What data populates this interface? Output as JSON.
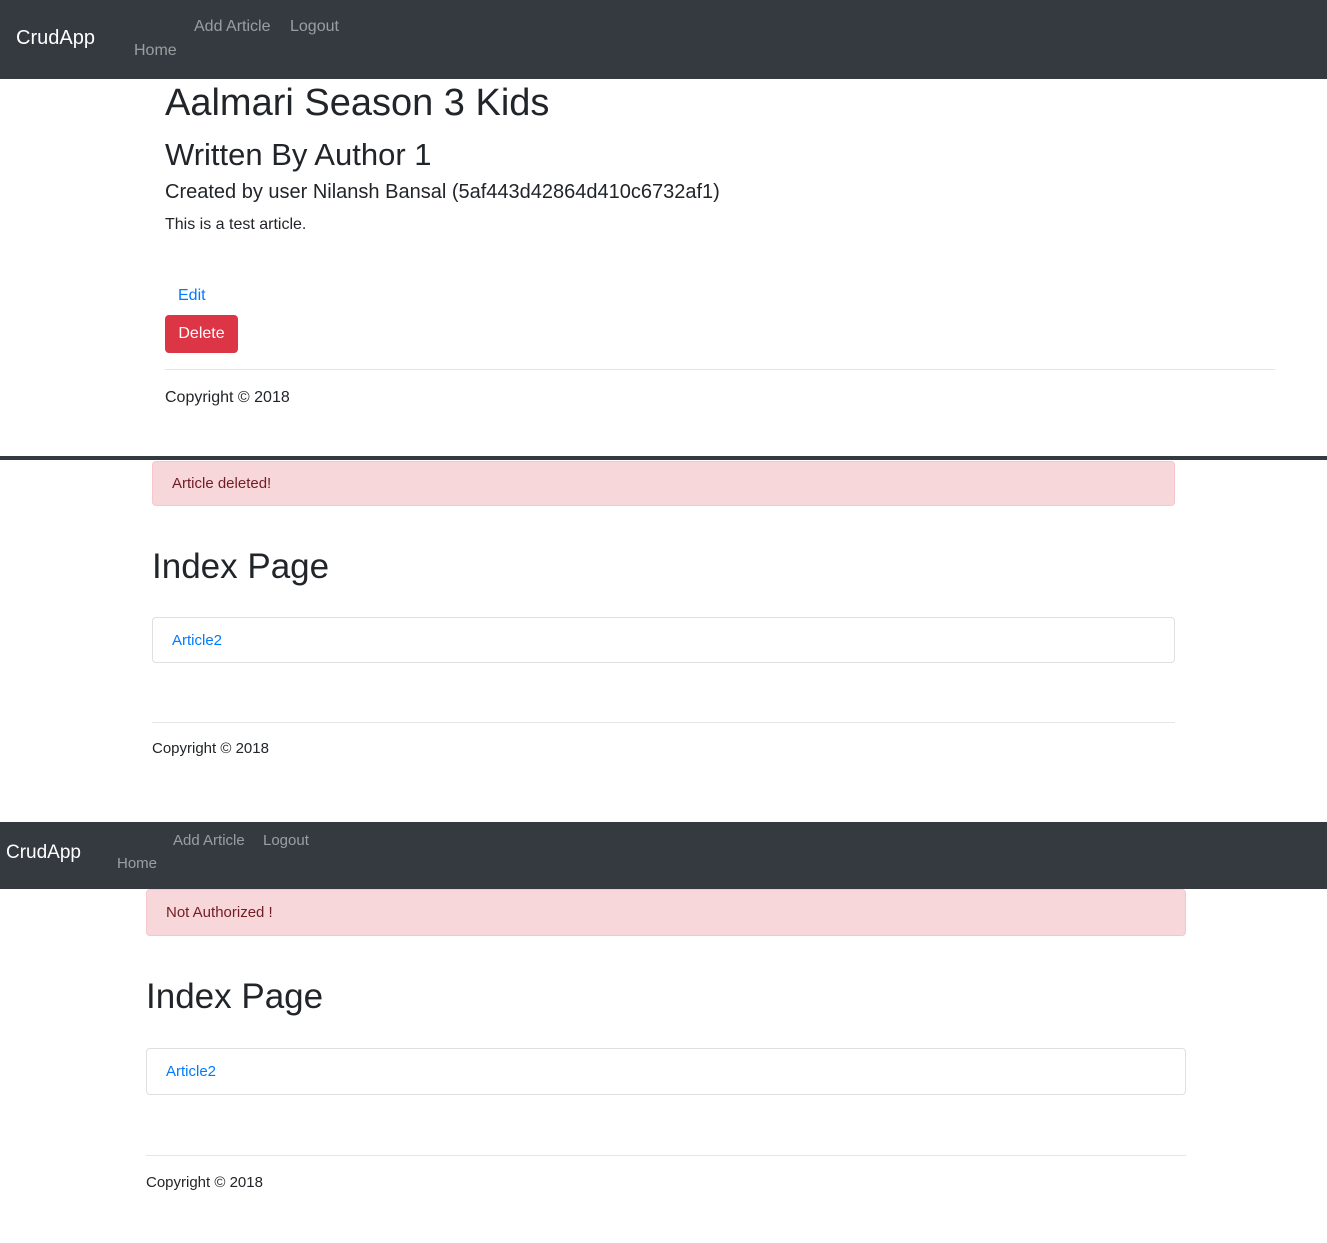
{
  "screen1": {
    "navbar": {
      "brand": "CrudApp",
      "links": [
        "Home",
        "Add Article",
        "Logout"
      ]
    },
    "article": {
      "title": "Aalmari Season 3 Kids",
      "author_line": "Written By Author 1",
      "created_line": "Created by user Nilansh Bansal (5af443d42864d410c6732af1)",
      "body": "This is a test article."
    },
    "actions": {
      "edit_label": "Edit",
      "delete_label": "Delete"
    },
    "footer": {
      "copyright": "Copyright © 2018"
    }
  },
  "screen2": {
    "alert": "Article deleted!",
    "heading": "Index Page",
    "articles": [
      "Article2"
    ],
    "footer": {
      "copyright": "Copyright © 2018"
    }
  },
  "screen3": {
    "navbar": {
      "brand": "CrudApp",
      "links": [
        "Home",
        "Add Article",
        "Logout"
      ]
    },
    "alert": "Not Authorized !",
    "heading": "Index Page",
    "articles": [
      "Article2"
    ],
    "footer": {
      "copyright": "Copyright © 2018"
    }
  },
  "colors": {
    "navbar_bg": "#343a40",
    "link": "#007bff",
    "danger": "#dc3545",
    "alert_bg": "#f8d7da",
    "alert_text": "#721c24"
  }
}
